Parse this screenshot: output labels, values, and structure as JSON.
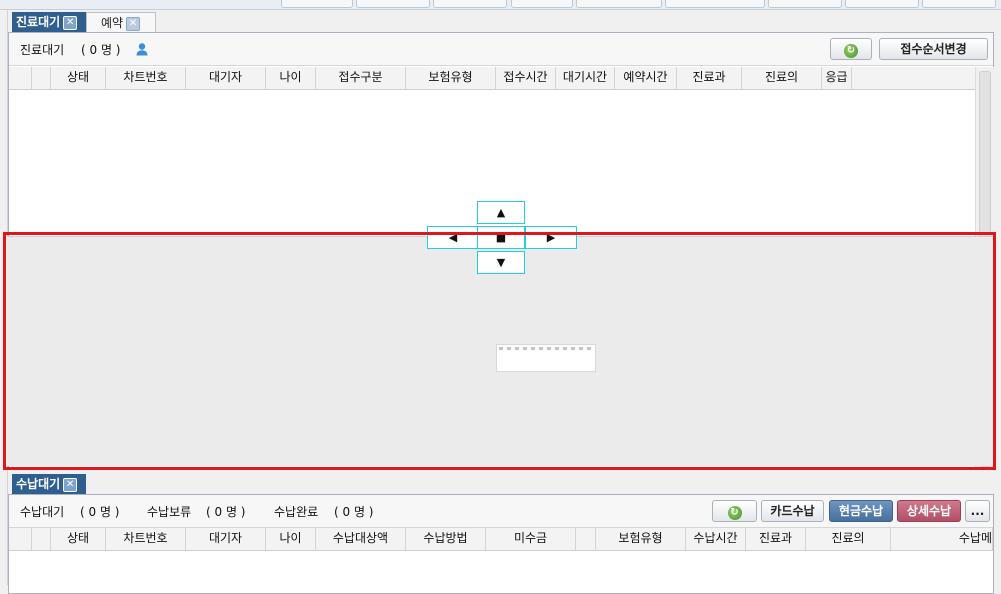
{
  "top_panel": {
    "tabs": [
      {
        "label": "진료대기",
        "active": true
      },
      {
        "label": "예약",
        "active": false
      }
    ],
    "summary": {
      "label": "진료대기",
      "count_text": "( 0 명 )"
    },
    "buttons": {
      "refresh": "↻",
      "reorder": "접수순서변경"
    },
    "columns": [
      "",
      "",
      "상태",
      "차트번호",
      "대기자",
      "나이",
      "접수구분",
      "보험유형",
      "접수시간",
      "대기시간",
      "예약시간",
      "진료과",
      "진료의",
      "응급"
    ]
  },
  "dock_arrows": {
    "up": "▲",
    "left": "◀",
    "center": "■",
    "right": "▶",
    "down": "▼"
  },
  "bottom_panel": {
    "tab": {
      "label": "수납대기"
    },
    "summary": {
      "waiting_label": "수납대기",
      "waiting_count": "( 0 명 )",
      "hold_label": "수납보류",
      "hold_count": "( 0 명 )",
      "done_label": "수납완료",
      "done_count": "( 0 명 )"
    },
    "buttons": {
      "refresh": "↻",
      "card": "카드수납",
      "cash": "현금수납",
      "detail": "상세수납",
      "more": "..."
    },
    "columns": [
      "",
      "",
      "상태",
      "차트번호",
      "대기자",
      "나이",
      "수납대상액",
      "수납방법",
      "미수금",
      "",
      "보험유형",
      "수납시간",
      "진료과",
      "진료의",
      "수납메"
    ]
  },
  "colors": {
    "tab_active": "#2f5f8f",
    "highlight_border": "#e0161b",
    "dock_border": "#20d0e0",
    "cash_button": "#48709e",
    "detail_button": "#b04e66"
  }
}
